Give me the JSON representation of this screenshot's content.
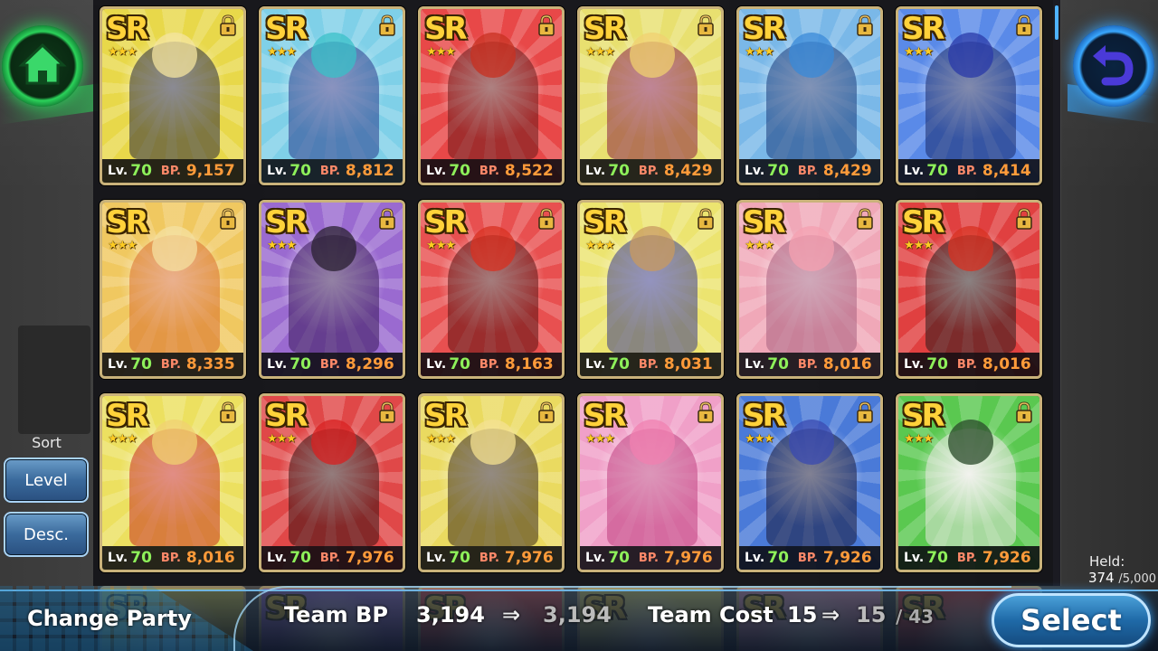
{
  "ui": {
    "sort_label": "Sort",
    "sort_level": "Level",
    "sort_order": "Desc.",
    "held_label": "Held:",
    "held_count": "374",
    "held_max": "/5,000",
    "change_party": "Change Party",
    "team_bp_label": "Team BP",
    "team_bp": "3,194",
    "team_bp_new": "3,194",
    "team_cost_label": "Team Cost",
    "team_cost": "15",
    "team_cost_new": "15",
    "team_cost_max": "/ 43",
    "arrow": "⇒",
    "select": "Select"
  },
  "cards": [
    {
      "rarity": "SR",
      "stars": "★★★",
      "lv_label": "Lv.",
      "level": "70",
      "bp_label": "BP.",
      "bp": "9,157",
      "bg": "#e8d84a",
      "accent": "#2a2a3a",
      "hair": "#f4e4a0"
    },
    {
      "rarity": "SR",
      "stars": "★★★",
      "lv_label": "Lv.",
      "level": "70",
      "bp_label": "BP.",
      "bp": "8,812",
      "bg": "#7fd0e8",
      "accent": "#2a3a8a",
      "hair": "#3ac0c8"
    },
    {
      "rarity": "SR",
      "stars": "★★★",
      "lv_label": "Lv.",
      "level": "70",
      "bp_label": "BP.",
      "bp": "8,522",
      "bg": "#e84848",
      "accent": "#6a1a1a",
      "hair": "#c83020"
    },
    {
      "rarity": "SR",
      "stars": "★★★",
      "lv_label": "Lv.",
      "level": "70",
      "bp_label": "BP.",
      "bp": "8,429",
      "bg": "#e8e070",
      "accent": "#8a2040",
      "hair": "#f0d070"
    },
    {
      "rarity": "SR",
      "stars": "★★★",
      "lv_label": "Lv.",
      "level": "70",
      "bp_label": "BP.",
      "bp": "8,429",
      "bg": "#7ab8e8",
      "accent": "#1a3a7a",
      "hair": "#3a8ad8"
    },
    {
      "rarity": "SR",
      "stars": "★★★",
      "lv_label": "Lv.",
      "level": "70",
      "bp_label": "BP.",
      "bp": "8,414",
      "bg": "#5a8ae8",
      "accent": "#1a2a6a",
      "hair": "#2a3aa8"
    },
    {
      "rarity": "SR",
      "stars": "★★★",
      "lv_label": "Lv.",
      "level": "70",
      "bp_label": "BP.",
      "bp": "8,335",
      "bg": "#f0c860",
      "accent": "#d87030",
      "hair": "#f4e0a0"
    },
    {
      "rarity": "SR",
      "stars": "★★★",
      "lv_label": "Lv.",
      "level": "70",
      "bp_label": "BP.",
      "bp": "8,296",
      "bg": "#9a6ad0",
      "accent": "#3a1a5a",
      "hair": "#2a2030"
    },
    {
      "rarity": "SR",
      "stars": "★★★",
      "lv_label": "Lv.",
      "level": "70",
      "bp_label": "BP.",
      "bp": "8,163",
      "bg": "#e85050",
      "accent": "#5a1010",
      "hair": "#d83020"
    },
    {
      "rarity": "SR",
      "stars": "★★★",
      "lv_label": "Lv.",
      "level": "70",
      "bp_label": "BP.",
      "bp": "8,031",
      "bg": "#ece470",
      "accent": "#3a3a8a",
      "hair": "#c89a60"
    },
    {
      "rarity": "SR",
      "stars": "★★★",
      "lv_label": "Lv.",
      "level": "70",
      "bp_label": "BP.",
      "bp": "8,016",
      "bg": "#f0a8b8",
      "accent": "#a86080",
      "hair": "#f4a0b0"
    },
    {
      "rarity": "SR",
      "stars": "★★★",
      "lv_label": "Lv.",
      "level": "70",
      "bp_label": "BP.",
      "bp": "8,016",
      "bg": "#e04040",
      "accent": "#2a1a1a",
      "hair": "#d83020"
    },
    {
      "rarity": "SR",
      "stars": "★★★",
      "lv_label": "Lv.",
      "level": "70",
      "bp_label": "BP.",
      "bp": "8,016",
      "bg": "#ece060",
      "accent": "#c83020",
      "hair": "#f0d070"
    },
    {
      "rarity": "SR",
      "stars": "★★★",
      "lv_label": "Lv.",
      "level": "70",
      "bp_label": "BP.",
      "bp": "7,976",
      "bg": "#e04848",
      "accent": "#3a1010",
      "hair": "#d82020"
    },
    {
      "rarity": "SR",
      "stars": "★★★",
      "lv_label": "Lv.",
      "level": "70",
      "bp_label": "BP.",
      "bp": "7,976",
      "bg": "#eada60",
      "accent": "#3a2a1a",
      "hair": "#f4e090"
    },
    {
      "rarity": "SR",
      "stars": "★★★",
      "lv_label": "Lv.",
      "level": "70",
      "bp_label": "BP.",
      "bp": "7,976",
      "bg": "#f0a0c8",
      "accent": "#c04080",
      "hair": "#f080b0"
    },
    {
      "rarity": "SR",
      "stars": "★★★",
      "lv_label": "Lv.",
      "level": "70",
      "bp_label": "BP.",
      "bp": "7,926",
      "bg": "#4a7ad8",
      "accent": "#1a1a3a",
      "hair": "#3a4ab0"
    },
    {
      "rarity": "SR",
      "stars": "★★★",
      "lv_label": "Lv.",
      "level": "70",
      "bp_label": "BP.",
      "bp": "7,926",
      "bg": "#5ac850",
      "accent": "#e8e8e0",
      "hair": "#2a4a2a"
    }
  ],
  "partial_cards": [
    {
      "rarity": "SR",
      "bg": "#e8d84a"
    },
    {
      "rarity": "SR",
      "bg": "#9a6ad0"
    },
    {
      "rarity": "SR",
      "bg": "#e84848"
    },
    {
      "rarity": "SR",
      "bg": "#ece470"
    },
    {
      "rarity": "SR",
      "bg": "#f0a0c8"
    },
    {
      "rarity": "SR",
      "bg": "#e04040"
    }
  ],
  "colors": {
    "home_glow": "#2bd35a",
    "back_glow": "#3aa8ff",
    "level_green": "#8ef05a",
    "bp_orange": "#ff9b3a"
  }
}
